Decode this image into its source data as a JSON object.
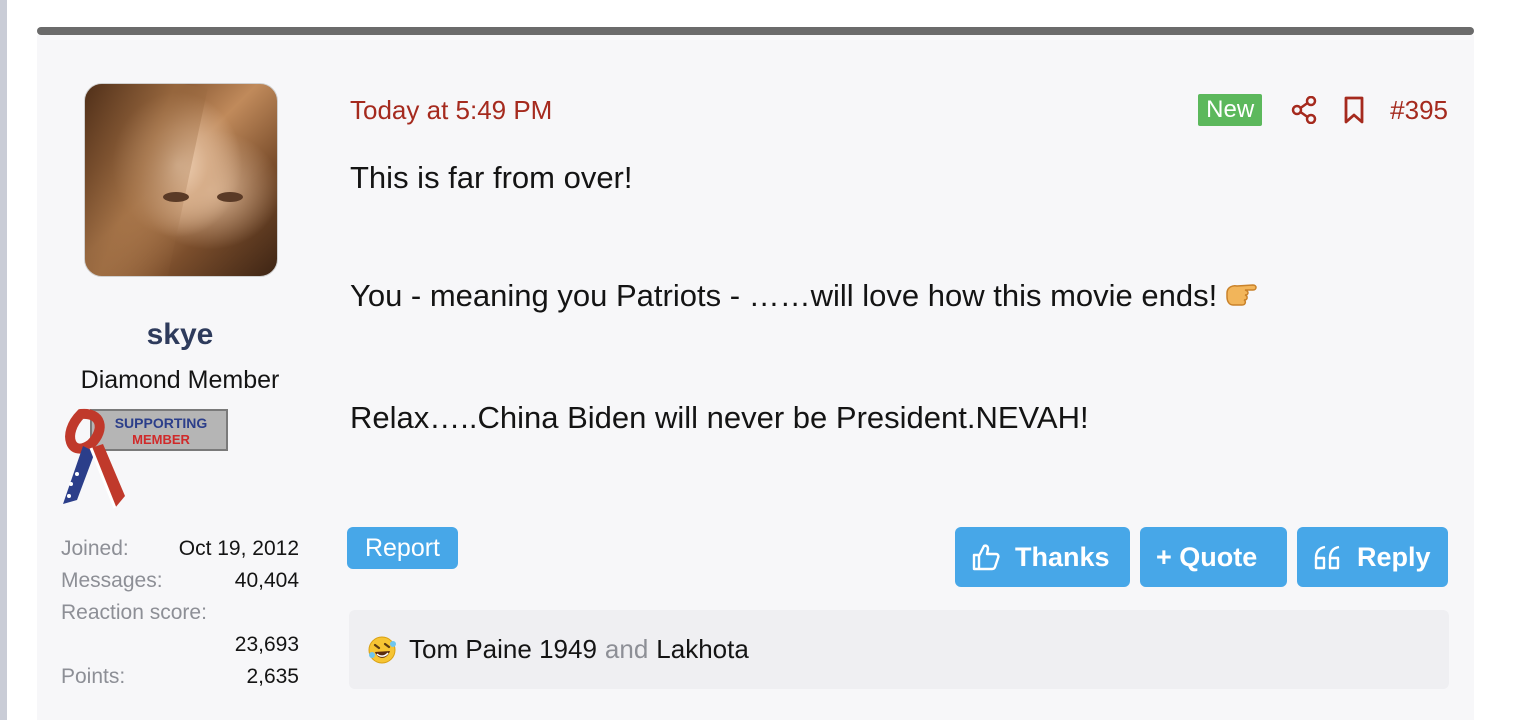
{
  "colors": {
    "accent_red": "#a52a1e",
    "button_blue": "#47a7e8",
    "new_badge_green": "#5cb85c",
    "username_navy": "#2e3b5c"
  },
  "user": {
    "name": "skye",
    "title": "Diamond Member",
    "banner": {
      "line1": "SUPPORTING",
      "line2": "MEMBER"
    },
    "stats": {
      "joined_label": "Joined:",
      "joined_value": "Oct 19, 2012",
      "messages_label": "Messages:",
      "messages_value": "40,404",
      "reaction_label": "Reaction score:",
      "reaction_value": "23,693",
      "points_label": "Points:",
      "points_value": "2,635"
    }
  },
  "post": {
    "date": "Today at 5:49 PM",
    "new_badge": "New",
    "number": "#395",
    "paragraphs": [
      "This is far from over!",
      "You - meaning you Patriots - ……will love how this movie ends!",
      "Relax…..China Biden will never be President.NEVAH!"
    ],
    "icons": [
      "share-icon",
      "bookmark-icon",
      "thumbs-pointing-emoji-icon"
    ]
  },
  "actions": {
    "report": "Report",
    "thanks": "Thanks",
    "quote": "+ Quote",
    "reply": "Reply"
  },
  "reactions": {
    "user1": "Tom Paine 1949",
    "and": "and",
    "user2": "Lakhota"
  }
}
